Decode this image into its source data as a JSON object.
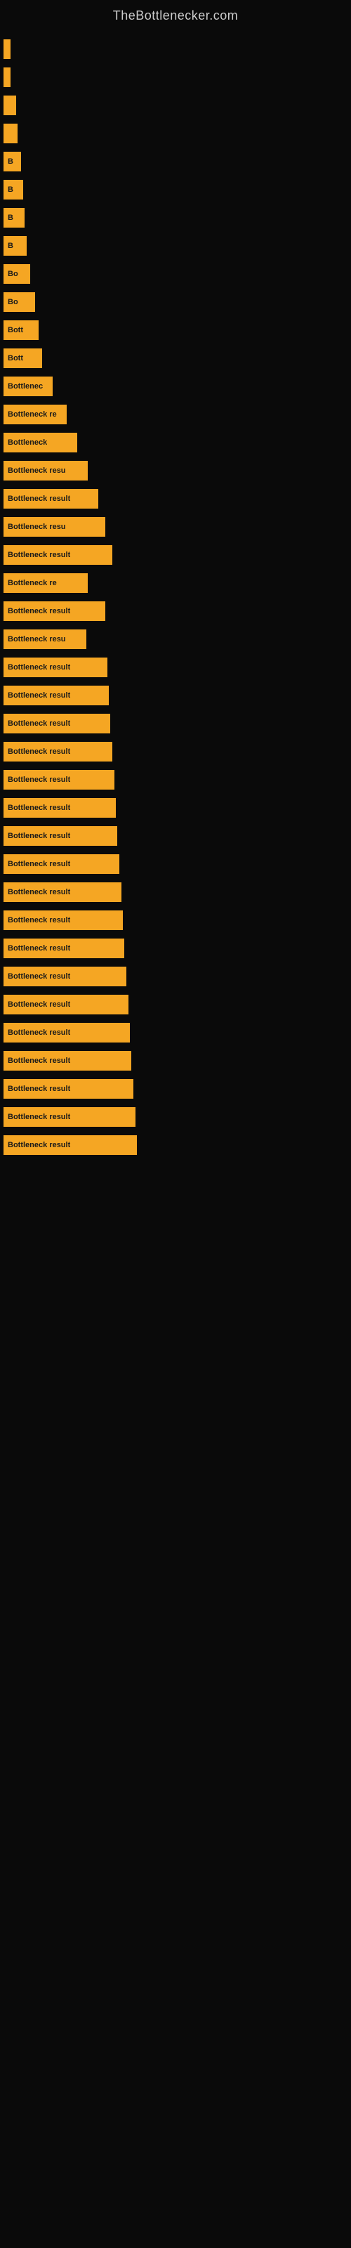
{
  "site": {
    "title": "TheBottlenecker.com"
  },
  "bars": [
    {
      "id": 1,
      "width_class": "bar-1",
      "label": ""
    },
    {
      "id": 2,
      "width_class": "bar-2",
      "label": ""
    },
    {
      "id": 3,
      "width_class": "bar-3",
      "label": ""
    },
    {
      "id": 4,
      "width_class": "bar-4",
      "label": ""
    },
    {
      "id": 5,
      "width_class": "bar-5",
      "label": "B"
    },
    {
      "id": 6,
      "width_class": "bar-6",
      "label": "B"
    },
    {
      "id": 7,
      "width_class": "bar-7",
      "label": "B"
    },
    {
      "id": 8,
      "width_class": "bar-8",
      "label": "B"
    },
    {
      "id": 9,
      "width_class": "bar-9",
      "label": "Bo"
    },
    {
      "id": 10,
      "width_class": "bar-10",
      "label": "Bo"
    },
    {
      "id": 11,
      "width_class": "bar-11",
      "label": "Bott"
    },
    {
      "id": 12,
      "width_class": "bar-12",
      "label": "Bott"
    },
    {
      "id": 13,
      "width_class": "bar-13",
      "label": "Bottlenec"
    },
    {
      "id": 14,
      "width_class": "bar-14",
      "label": "Bottleneck re"
    },
    {
      "id": 15,
      "width_class": "bar-15",
      "label": "Bottleneck"
    },
    {
      "id": 16,
      "width_class": "bar-16",
      "label": "Bottleneck resu"
    },
    {
      "id": 17,
      "width_class": "bar-17",
      "label": "Bottleneck result"
    },
    {
      "id": 18,
      "width_class": "bar-18",
      "label": "Bottleneck resu"
    },
    {
      "id": 19,
      "width_class": "bar-19",
      "label": "Bottleneck result"
    },
    {
      "id": 20,
      "width_class": "bar-20",
      "label": "Bottleneck re"
    },
    {
      "id": 21,
      "width_class": "bar-21",
      "label": "Bottleneck result"
    },
    {
      "id": 22,
      "width_class": "bar-22",
      "label": "Bottleneck resu"
    },
    {
      "id": 23,
      "width_class": "bar-23",
      "label": "Bottleneck result"
    },
    {
      "id": 24,
      "width_class": "bar-24",
      "label": "Bottleneck result"
    },
    {
      "id": 25,
      "width_class": "bar-25",
      "label": "Bottleneck result"
    },
    {
      "id": 26,
      "width_class": "bar-26",
      "label": "Bottleneck result"
    },
    {
      "id": 27,
      "width_class": "bar-27",
      "label": "Bottleneck result"
    },
    {
      "id": 28,
      "width_class": "bar-28",
      "label": "Bottleneck result"
    },
    {
      "id": 29,
      "width_class": "bar-29",
      "label": "Bottleneck result"
    },
    {
      "id": 30,
      "width_class": "bar-30",
      "label": "Bottleneck result"
    },
    {
      "id": 31,
      "width_class": "bar-31",
      "label": "Bottleneck result"
    },
    {
      "id": 32,
      "width_class": "bar-32",
      "label": "Bottleneck result"
    },
    {
      "id": 33,
      "width_class": "bar-33",
      "label": "Bottleneck result"
    },
    {
      "id": 34,
      "width_class": "bar-34",
      "label": "Bottleneck result"
    },
    {
      "id": 35,
      "width_class": "bar-35",
      "label": "Bottleneck result"
    },
    {
      "id": 36,
      "width_class": "bar-36",
      "label": "Bottleneck result"
    },
    {
      "id": 37,
      "width_class": "bar-37",
      "label": "Bottleneck result"
    },
    {
      "id": 38,
      "width_class": "bar-38",
      "label": "Bottleneck result"
    },
    {
      "id": 39,
      "width_class": "bar-39",
      "label": "Bottleneck result"
    },
    {
      "id": 40,
      "width_class": "bar-40",
      "label": "Bottleneck result"
    }
  ]
}
